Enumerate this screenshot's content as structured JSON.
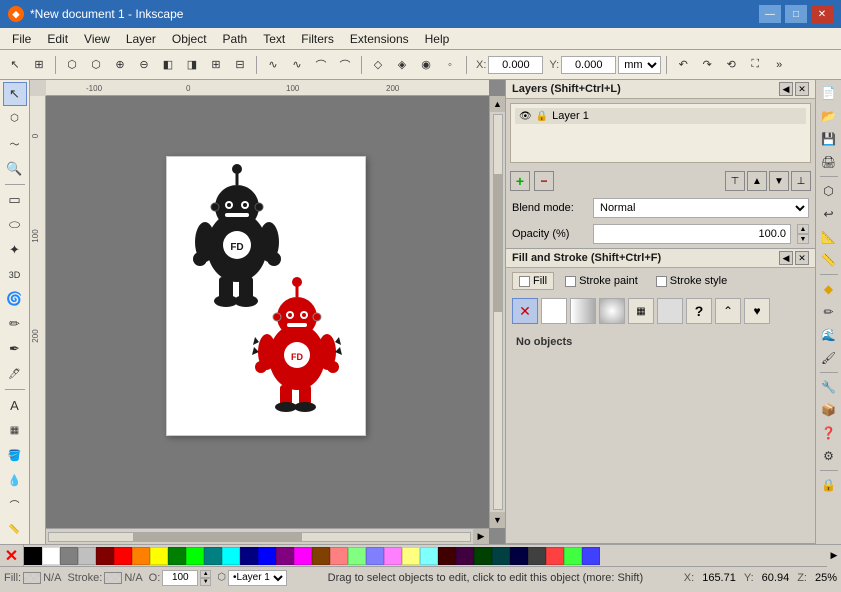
{
  "window": {
    "title": "*New document 1 - Inkscape",
    "icon": "♦"
  },
  "titlebar": {
    "minimize": "—",
    "maximize": "□",
    "close": "✕"
  },
  "menubar": {
    "items": [
      "File",
      "Edit",
      "View",
      "Layer",
      "Object",
      "Path",
      "Text",
      "Filters",
      "Extensions",
      "Help"
    ]
  },
  "toolbar": {
    "x_label": "X:",
    "x_value": "0.000",
    "y_label": "Y:",
    "y_value": "0.000",
    "unit": "mm"
  },
  "layers_panel": {
    "title": "Layers (Shift+Ctrl+L)",
    "layer_name": "Layer 1",
    "blend_label": "Blend mode:",
    "blend_value": "Normal",
    "opacity_label": "Opacity (%)",
    "opacity_value": "100.0"
  },
  "fill_stroke_panel": {
    "title": "Fill and Stroke (Shift+Ctrl+F)",
    "tabs": [
      "Fill",
      "Stroke paint",
      "Stroke style"
    ],
    "no_objects_text": "No objects"
  },
  "statusbar": {
    "fill_label": "Fill:",
    "fill_value": "N/A",
    "stroke_label": "Stroke:",
    "stroke_value": "N/A",
    "opacity_label": "O:",
    "opacity_value": "100",
    "layer": "Layer 1",
    "info": "Drag to select objects to edit, click to edit this object (more: Shift)",
    "x_label": "X:",
    "x_value": "165.71",
    "y_label": "Y:",
    "y_value": "60.94",
    "zoom_label": "Z:",
    "zoom_value": "25%"
  },
  "left_tools": [
    "↖",
    "✂",
    "⬡",
    "✏",
    "✒",
    "🖊",
    "📝",
    "A",
    "✦",
    "⭕",
    "⬡",
    "⭐",
    "🌊",
    "💧",
    "🖌",
    "🔍",
    "🪣",
    "✏",
    "💡"
  ],
  "right_tools": [
    "📄",
    "📂",
    "💾",
    "🖨",
    "⭕",
    "🔄",
    "📐",
    "📏",
    "⬡",
    "🎨",
    "✏",
    "🌊",
    "🖌",
    "🔧",
    "📦",
    "❓",
    "⚙",
    "🔒"
  ],
  "palette_colors": [
    "#000000",
    "#ffffff",
    "#808080",
    "#c0c0c0",
    "#800000",
    "#ff0000",
    "#ff8000",
    "#ffff00",
    "#008000",
    "#00ff00",
    "#008080",
    "#00ffff",
    "#000080",
    "#0000ff",
    "#800080",
    "#ff00ff",
    "#804000",
    "#ff8080",
    "#80ff80",
    "#8080ff",
    "#ff80ff",
    "#ffff80",
    "#80ffff",
    "#400000",
    "#400040",
    "#004000",
    "#004040",
    "#000040",
    "#404040",
    "#ff4040",
    "#40ff40",
    "#4040ff"
  ]
}
